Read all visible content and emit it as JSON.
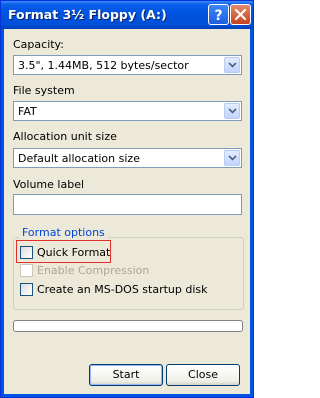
{
  "window": {
    "title": "Format 3½ Floppy (A:)"
  },
  "title_buttons": {
    "help": "?",
    "close": "×"
  },
  "capacity": {
    "label": "Capacity:",
    "value": "3.5\",  1.44MB, 512 bytes/sector"
  },
  "file_system": {
    "label": "File system",
    "value": "FAT"
  },
  "allocation": {
    "label": "Allocation unit size",
    "value": "Default allocation size"
  },
  "volume": {
    "label": "Volume label",
    "value": ""
  },
  "format_options": {
    "title": "Format options",
    "quick_format": {
      "label": "Quick Format",
      "checked": false,
      "enabled": true
    },
    "enable_compression": {
      "label": "Enable Compression",
      "checked": false,
      "enabled": false
    },
    "msdos_startup": {
      "label": "Create an MS-DOS startup disk",
      "checked": false,
      "enabled": true
    }
  },
  "progress": {
    "value": 0
  },
  "buttons": {
    "start": "Start",
    "close": "Close"
  },
  "colors": {
    "titlebar": "#0054e3",
    "dialog_bg": "#ece9d8",
    "group_title": "#0046d5",
    "highlight": "#e0302b"
  }
}
